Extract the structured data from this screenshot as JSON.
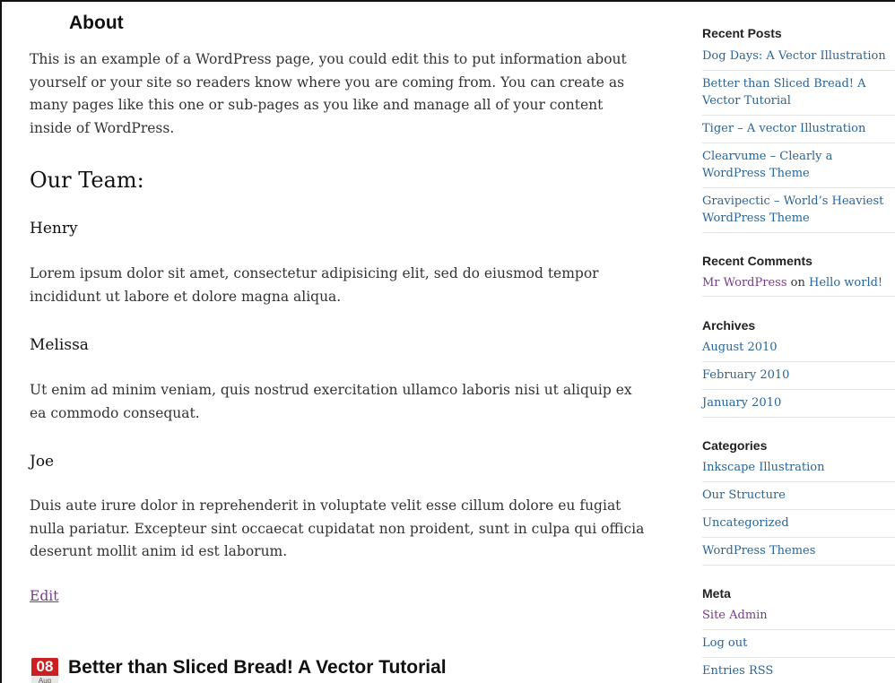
{
  "page": {
    "title": "About",
    "intro": "This is an example of a WordPress page, you could edit this to put information about yourself or your site so readers know where you are coming from. You can create as many pages like this one or sub-pages as you like and manage all of your content inside of WordPress.",
    "team_heading": "Our Team:",
    "members": [
      {
        "name": "Henry",
        "text": "Lorem ipsum dolor sit amet, consectetur adipisicing elit, sed do eiusmod tempor incididunt ut labore et dolore magna aliqua."
      },
      {
        "name": "Melissa",
        "text": "Ut enim ad minim veniam, quis nostrud exercitation ullamco laboris nisi ut aliquip ex ea commodo consequat."
      },
      {
        "name": "Joe",
        "text": "Duis aute irure dolor in reprehenderit in voluptate velit esse cillum dolore eu fugiat nulla pariatur. Excepteur sint occaecat cupidatat non proident, sunt in culpa qui officia deserunt mollit anim id est laborum."
      }
    ],
    "edit_label": "Edit"
  },
  "next_post": {
    "date_day": "08",
    "date_month": "Aug",
    "title": "Better than Sliced Bread! A Vector Tutorial"
  },
  "sidebar": {
    "recent_posts": {
      "title": "Recent Posts",
      "items": [
        "Dog Days: A Vector Illustration",
        "Better than Sliced Bread! A Vector Tutorial",
        "Tiger – A vector Illustration",
        "Clearvume – Clearly a WordPress Theme",
        "Gravipectic – World’s Heaviest WordPress Theme"
      ]
    },
    "recent_comments": {
      "title": "Recent Comments",
      "author": "Mr WordPress",
      "on": "on",
      "post": "Hello world!"
    },
    "archives": {
      "title": "Archives",
      "items": [
        "August 2010",
        "February 2010",
        "January 2010"
      ]
    },
    "categories": {
      "title": "Categories",
      "items": [
        "Inkscape Illustration",
        "Our Structure",
        "Uncategorized",
        "WordPress Themes"
      ]
    },
    "meta": {
      "title": "Meta",
      "items": [
        "Site Admin",
        "Log out",
        "Entries RSS"
      ]
    }
  },
  "colors": {
    "link": "#2a6496",
    "visited_link": "#7a3b8c",
    "date_badge": "#cc1f1f"
  }
}
